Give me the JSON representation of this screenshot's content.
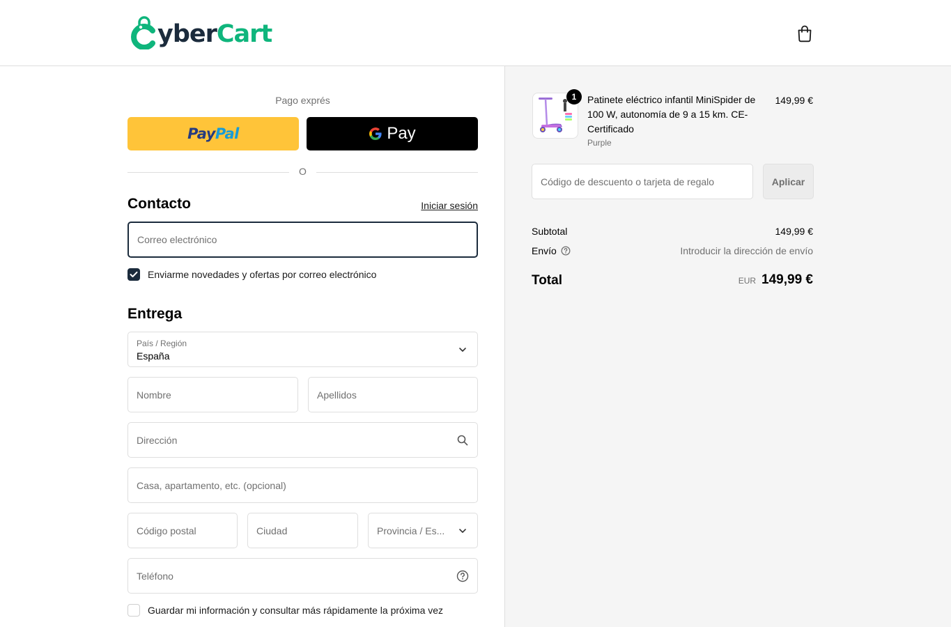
{
  "header": {
    "logo_prefix": "yber",
    "logo_suffix": "Cart",
    "bag_icon": "shopping-bag-icon"
  },
  "express": {
    "label": "Pago exprés",
    "paypal_part1": "Pay",
    "paypal_part2": "Pal",
    "gpay_label": "Pay",
    "divider_text": "O"
  },
  "contact": {
    "title": "Contacto",
    "login_link": "Iniciar sesión",
    "email_placeholder": "Correo electrónico",
    "newsletter_label": "Enviarme novedades y ofertas por correo electrónico",
    "newsletter_checked": true
  },
  "delivery": {
    "title": "Entrega",
    "country_label": "País / Región",
    "country_value": "España",
    "first_name_placeholder": "Nombre",
    "last_name_placeholder": "Apellidos",
    "address_placeholder": "Dirección",
    "apartment_placeholder": "Casa, apartamento, etc. (opcional)",
    "postal_placeholder": "Código postal",
    "city_placeholder": "Ciudad",
    "province_placeholder": "Provincia / Es...",
    "phone_placeholder": "Teléfono",
    "save_info_label": "Guardar mi información y consultar más rápidamente la próxima vez",
    "save_info_checked": false
  },
  "summary": {
    "product": {
      "name": "Patinete eléctrico infantil MiniSpider de 100 W, autonomía de 9 a 15 km. CE-Certificado",
      "variant": "Purple",
      "price": "149,99 €",
      "quantity": "1"
    },
    "discount_placeholder": "Código de descuento o tarjeta de regalo",
    "apply_label": "Aplicar",
    "subtotal_label": "Subtotal",
    "subtotal_value": "149,99 €",
    "shipping_label": "Envío",
    "shipping_value": "Introducir la dirección de envío",
    "total_label": "Total",
    "total_currency": "EUR",
    "total_value": "149,99 €"
  },
  "colors": {
    "brand_dark": "#1b2b3c",
    "brand_green": "#0fb57c",
    "paypal_yellow": "#ffc439",
    "paypal_dark_blue": "#253b80",
    "paypal_light_blue": "#179bd7"
  }
}
